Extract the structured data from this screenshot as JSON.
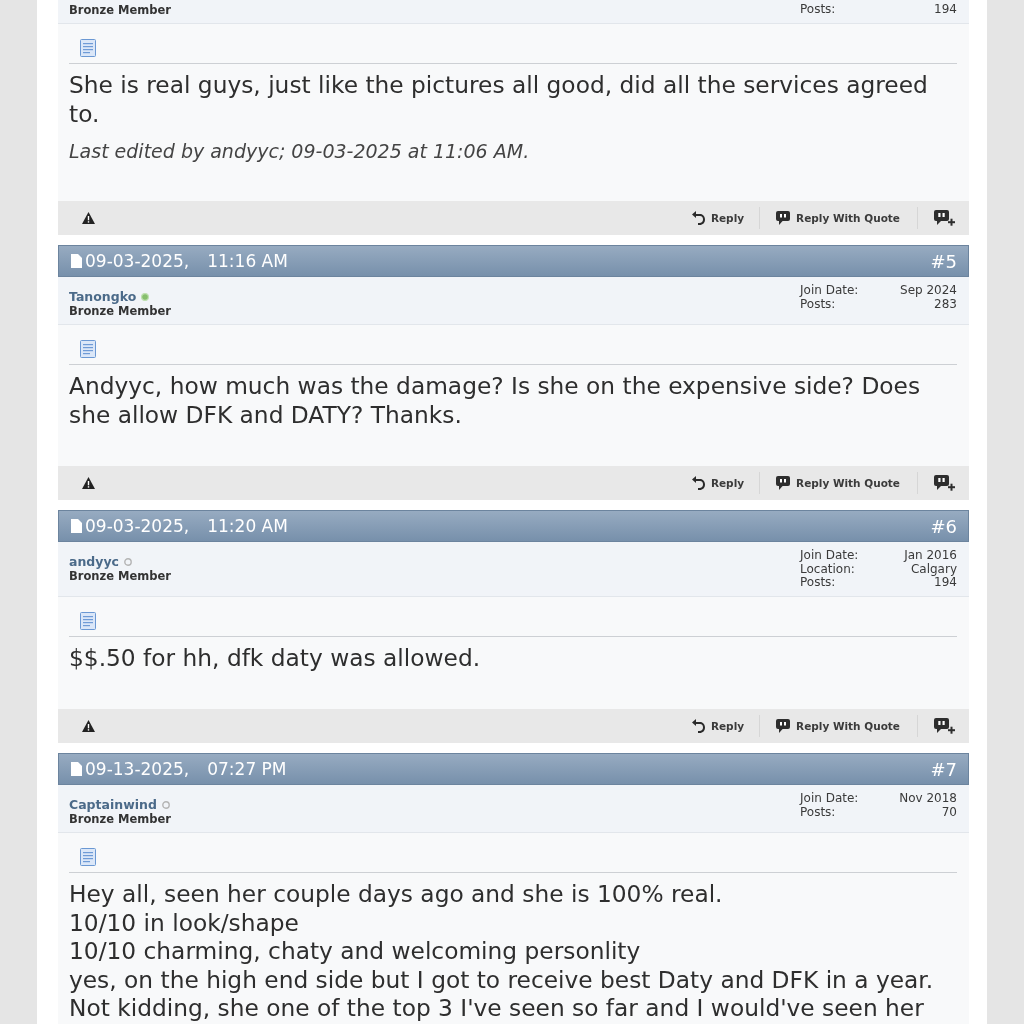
{
  "posts": [
    {
      "user": {
        "rank": "Bronze Member"
      },
      "stats": [
        {
          "label": "Posts:",
          "value": "194"
        }
      ],
      "message": [
        "She is real guys, just like the pictures all good, did all the services agreed to."
      ],
      "edit_note": "Last edited by andyyc; 09-03-2025 at 11:06 AM.",
      "actions": [
        "Reply",
        "Reply With Quote"
      ]
    },
    {
      "date": "09-03-2025,",
      "time": "11:16 AM",
      "number": "#5",
      "user": {
        "name": "Tanongko",
        "online": true,
        "rank": "Bronze Member"
      },
      "stats": [
        {
          "label": "Join Date:",
          "value": "Sep 2024"
        },
        {
          "label": "Posts:",
          "value": "283"
        }
      ],
      "message": [
        "Andyyc, how much was the damage? Is she on the expensive side? Does she allow DFK and DATY? Thanks."
      ],
      "actions": [
        "Reply",
        "Reply With Quote"
      ]
    },
    {
      "date": "09-03-2025,",
      "time": "11:20 AM",
      "number": "#6",
      "user": {
        "name": "andyyc",
        "online": false,
        "rank": "Bronze Member"
      },
      "stats": [
        {
          "label": "Join Date:",
          "value": "Jan 2016"
        },
        {
          "label": "Location:",
          "value": "Calgary"
        },
        {
          "label": "Posts:",
          "value": "194"
        }
      ],
      "message": [
        "$$.50 for hh, dfk daty was allowed."
      ],
      "actions": [
        "Reply",
        "Reply With Quote"
      ]
    },
    {
      "date": "09-13-2025,",
      "time": "07:27 PM",
      "number": "#7",
      "user": {
        "name": "Captainwind",
        "online": false,
        "rank": "Bronze Member"
      },
      "stats": [
        {
          "label": "Join Date:",
          "value": "Nov 2018"
        },
        {
          "label": "Posts:",
          "value": "70"
        }
      ],
      "message": [
        "Hey all, seen her couple days ago and she is 100% real.",
        "10/10 in look/shape",
        "10/10 charming, chaty and welcoming personlity",
        "yes, on the high end side but I got to receive best Daty and DFK in a year.",
        "Not kidding, she one of the top 3 I've seen so far and I would've seen her"
      ]
    }
  ]
}
